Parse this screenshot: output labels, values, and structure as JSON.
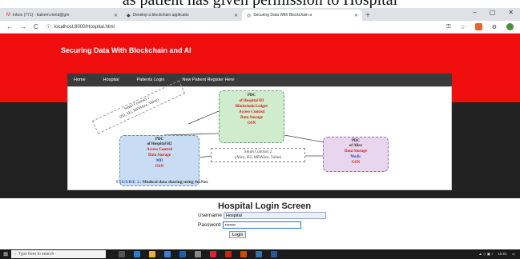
{
  "overlay_text": "as patient has given permission to Hospital",
  "browser": {
    "tabs": [
      {
        "label": "Inbox (771) - kaleem.mmd@gm",
        "favicon": "gmail-icon",
        "active": false
      },
      {
        "label": "Develop a blockchain applicatio",
        "favicon": "app-icon",
        "active": false
      },
      {
        "label": "Securing Data With Blockchain a",
        "favicon": "chrome-icon",
        "active": true
      }
    ],
    "new_tab": "+",
    "url": "localhost:8000/Hospital.html",
    "window_controls": {
      "minimize": "–",
      "maximize": "▢",
      "close": "✕"
    }
  },
  "site": {
    "title": "Securing Data With Blockchain and AI",
    "menu": [
      "Home",
      "Hospital",
      "Patients Login",
      "New Patient Register Here"
    ]
  },
  "figure": {
    "pdc_top": {
      "title": "PDC",
      "subtitle": "of Hospital H1",
      "rows": [
        "Blockchain Ledger",
        "Access Control",
        "Data Storage",
        "OSN"
      ]
    },
    "pdc_left": {
      "title": "PDC",
      "subtitle": "of Hospital H2",
      "rows": [
        "Access Control",
        "Data Storage",
        "MD",
        "OSN"
      ]
    },
    "pdc_right": {
      "title": "PDC",
      "subtitle": "of Alice",
      "rows": [
        "Data Storage",
        "Medic",
        "OSN"
      ]
    },
    "smart_contract_1": {
      "line1": "Smart Contract 1",
      "line2": "(H1, H2, MDAlice, Value)"
    },
    "smart_contract_2": {
      "line1": "Smart Contract 2",
      "line2": "(Alice, H2, MDAlice, Value)"
    },
    "caption_label": "FIGURE 2.",
    "caption_text": "Medical data sharing using SecNet."
  },
  "login": {
    "title": "Hospital Login Screen",
    "username_label": "Username",
    "username_value": "Hospital",
    "password_label": "Password",
    "password_value": "•••••••",
    "button": "Login"
  },
  "taskbar": {
    "search_placeholder": "Type here to search",
    "time": "18:01"
  }
}
